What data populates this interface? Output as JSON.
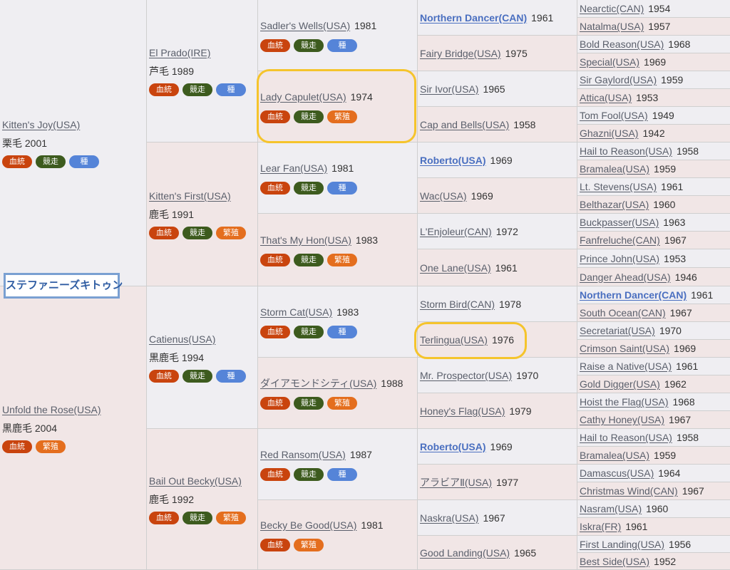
{
  "subject": {
    "name": "ステファニーズキトゥン"
  },
  "badges": {
    "blood": "血統",
    "race": "競走",
    "sire": "種",
    "broodmare": "繁殖"
  },
  "sire_side": {
    "sire": {
      "name": "Kitten's Joy(USA)",
      "info": "栗毛 2001"
    },
    "gen2_sire": {
      "name": "El Prado(IRE)",
      "info": "芦毛 1989"
    },
    "gen2_dam": {
      "name": "Kitten's First(USA)",
      "info": "鹿毛 1991"
    },
    "gen3": [
      {
        "name": "Sadler's Wells(USA)",
        "year": "1981"
      },
      {
        "name": "Lady Capulet(USA)",
        "year": "1974"
      },
      {
        "name": "Lear Fan(USA)",
        "year": "1981"
      },
      {
        "name": "That's My Hon(USA)",
        "year": "1983"
      }
    ],
    "gen4": [
      {
        "name": "Northern Dancer(CAN)",
        "year": "1961"
      },
      {
        "name": "Fairy Bridge(USA)",
        "year": "1975"
      },
      {
        "name": "Sir Ivor(USA)",
        "year": "1965"
      },
      {
        "name": "Cap and Bells(USA)",
        "year": "1958"
      },
      {
        "name": "Roberto(USA)",
        "year": "1969"
      },
      {
        "name": "Wac(USA)",
        "year": "1969"
      },
      {
        "name": "L'Enjoleur(CAN)",
        "year": "1972"
      },
      {
        "name": "One Lane(USA)",
        "year": "1961"
      }
    ],
    "gen5": [
      {
        "name": "Nearctic(CAN)",
        "year": "1954"
      },
      {
        "name": "Natalma(USA)",
        "year": "1957"
      },
      {
        "name": "Bold Reason(USA)",
        "year": "1968"
      },
      {
        "name": "Special(USA)",
        "year": "1969"
      },
      {
        "name": "Sir Gaylord(USA)",
        "year": "1959"
      },
      {
        "name": "Attica(USA)",
        "year": "1953"
      },
      {
        "name": "Tom Fool(USA)",
        "year": "1949"
      },
      {
        "name": "Ghazni(USA)",
        "year": "1942"
      },
      {
        "name": "Hail to Reason(USA)",
        "year": "1958"
      },
      {
        "name": "Bramalea(USA)",
        "year": "1959"
      },
      {
        "name": "Lt. Stevens(USA)",
        "year": "1961"
      },
      {
        "name": "Belthazar(USA)",
        "year": "1960"
      },
      {
        "name": "Buckpasser(USA)",
        "year": "1963"
      },
      {
        "name": "Fanfreluche(CAN)",
        "year": "1967"
      },
      {
        "name": "Prince John(USA)",
        "year": "1953"
      },
      {
        "name": "Danger Ahead(USA)",
        "year": "1946"
      }
    ]
  },
  "dam_side": {
    "dam": {
      "name": "Unfold the Rose(USA)",
      "info": "黒鹿毛 2004"
    },
    "gen2_sire": {
      "name": "Catienus(USA)",
      "info": "黒鹿毛 1994"
    },
    "gen2_dam": {
      "name": "Bail Out Becky(USA)",
      "info": "鹿毛 1992"
    },
    "gen3": [
      {
        "name": "Storm Cat(USA)",
        "year": "1983"
      },
      {
        "name": "ダイアモンドシティ(USA)",
        "year": "1988"
      },
      {
        "name": "Red Ransom(USA)",
        "year": "1987"
      },
      {
        "name": "Becky Be Good(USA)",
        "year": "1981"
      }
    ],
    "gen4": [
      {
        "name": "Storm Bird(CAN)",
        "year": "1978"
      },
      {
        "name": "Terlingua(USA)",
        "year": "1976"
      },
      {
        "name": "Mr. Prospector(USA)",
        "year": "1970"
      },
      {
        "name": "Honey's Flag(USA)",
        "year": "1979"
      },
      {
        "name": "Roberto(USA)",
        "year": "1969"
      },
      {
        "name": "アラビアⅡ(USA)",
        "year": "1977"
      },
      {
        "name": "Naskra(USA)",
        "year": "1967"
      },
      {
        "name": "Good Landing(USA)",
        "year": "1965"
      }
    ],
    "gen5": [
      {
        "name": "Northern Dancer(CAN)",
        "year": "1961"
      },
      {
        "name": "South Ocean(CAN)",
        "year": "1967"
      },
      {
        "name": "Secretariat(USA)",
        "year": "1970"
      },
      {
        "name": "Crimson Saint(USA)",
        "year": "1969"
      },
      {
        "name": "Raise a Native(USA)",
        "year": "1961"
      },
      {
        "name": "Gold Digger(USA)",
        "year": "1962"
      },
      {
        "name": "Hoist the Flag(USA)",
        "year": "1968"
      },
      {
        "name": "Cathy Honey(USA)",
        "year": "1967"
      },
      {
        "name": "Hail to Reason(USA)",
        "year": "1958"
      },
      {
        "name": "Bramalea(USA)",
        "year": "1959"
      },
      {
        "name": "Damascus(USA)",
        "year": "1964"
      },
      {
        "name": "Christmas Wind(CAN)",
        "year": "1967"
      },
      {
        "name": "Nasram(USA)",
        "year": "1960"
      },
      {
        "name": "Iskra(FR)",
        "year": "1961"
      },
      {
        "name": "First Landing(USA)",
        "year": "1956"
      },
      {
        "name": "Best Side(USA)",
        "year": "1952"
      }
    ]
  }
}
